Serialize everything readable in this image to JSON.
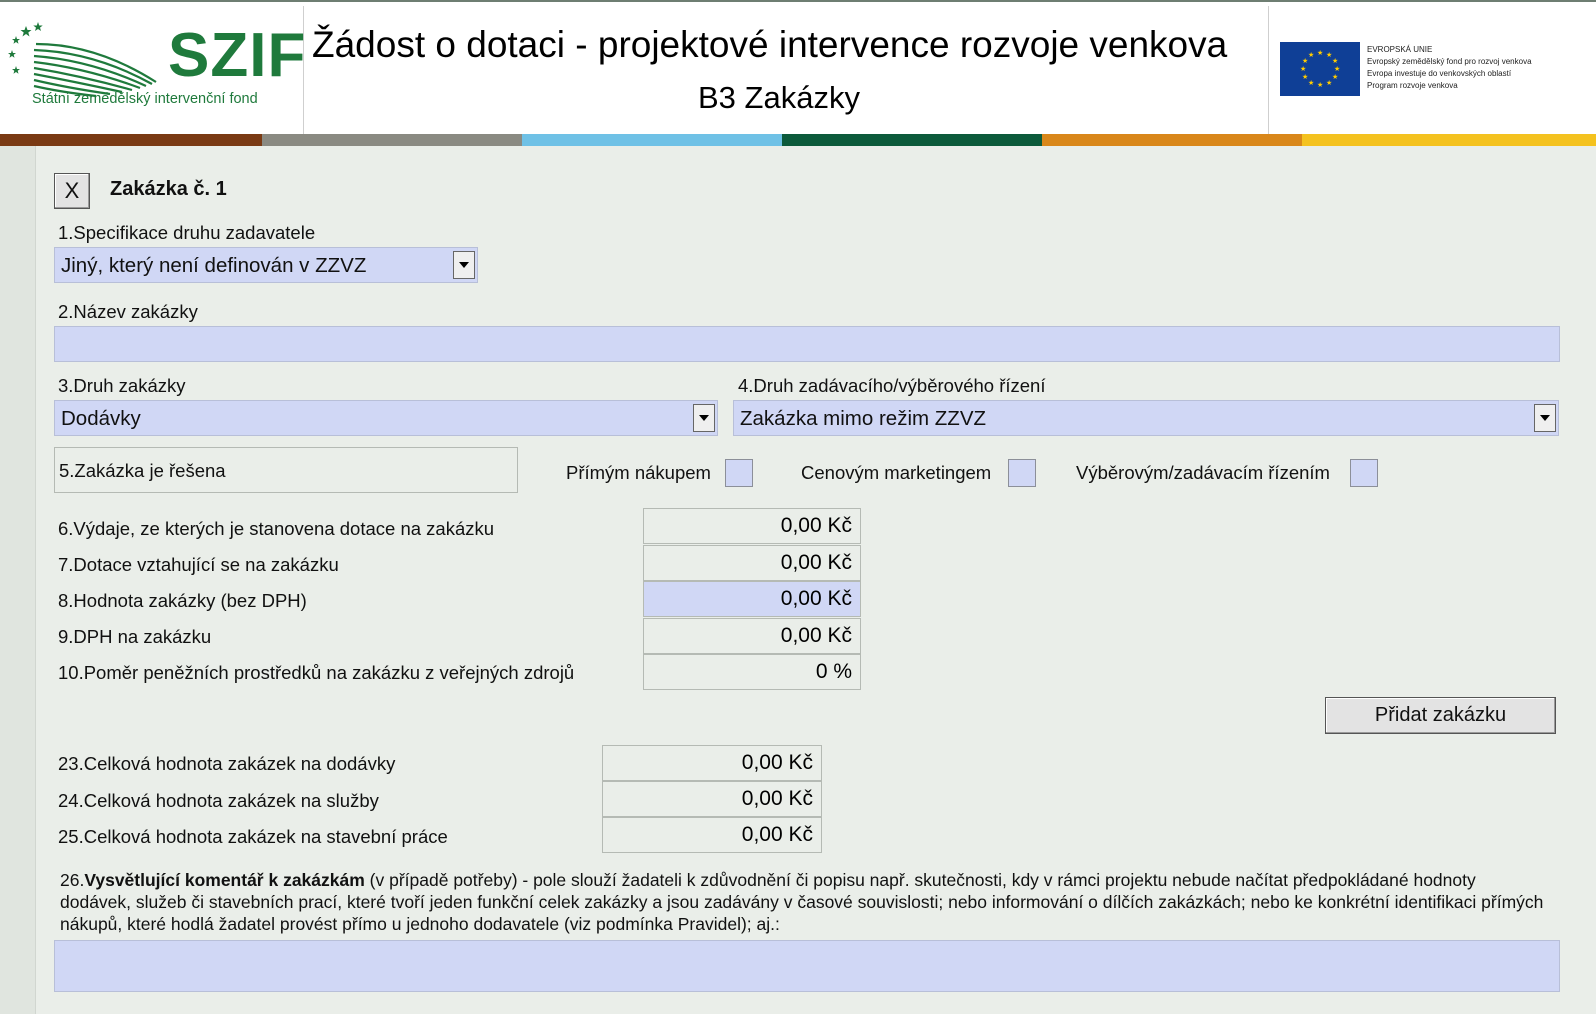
{
  "header": {
    "logo_text": "SZIF",
    "logo_subtitle": "Státní zemědělský intervenční fond",
    "title": "Žádost o dotaci - projektové intervence rozvoje venkova",
    "subtitle": "B3 Zakázky",
    "eu_lines": [
      "EVROPSKÁ UNIE",
      "Evropský zemědělský fond pro rozvoj venkova",
      "Evropa investuje do venkovských oblastí",
      "Program rozvoje venkova"
    ]
  },
  "stripe_colors": [
    "#7a3a14",
    "#8a8a82",
    "#6fc1e6",
    "#0c5a3b",
    "#d9871a",
    "#f4c21f"
  ],
  "contract": {
    "remove_label": "X",
    "heading": "Zakázka č. 1",
    "f1_label": "1.Specifikace druhu zadavatele",
    "f1_value": "Jiný, který není definován v ZZVZ",
    "f2_label": "2.Název zakázky",
    "f2_value": "",
    "f3_label": "3.Druh zakázky",
    "f3_value": "Dodávky",
    "f4_label": "4.Druh zadávacího/výběrového řízení",
    "f4_value": "Zakázka mimo režim ZZVZ",
    "f5_label": "5.Zakázka je řešena",
    "opt_direct": "Přímým nákupem",
    "opt_price": "Cenovým marketingem",
    "opt_tender": "Výběrovým/zadávacím řízením",
    "f6_label": "6.Výdaje, ze kterých je stanovena dotace na zakázku",
    "f6_value": "0,00 Kč",
    "f7_label": "7.Dotace vztahující se na zakázku",
    "f7_value": "0,00 Kč",
    "f8_label": "8.Hodnota zakázky (bez DPH)",
    "f8_value": "0,00 Kč",
    "f9_label": "9.DPH na zakázku",
    "f9_value": "0,00 Kč",
    "f10_label": "10.Poměr peněžních prostředků na zakázku z veřejných zdrojů",
    "f10_value": "0 %"
  },
  "add_button": "Přidat zakázku",
  "totals": {
    "t23_label": "23.Celková hodnota zakázek na dodávky",
    "t23_value": "0,00 Kč",
    "t24_label": "24.Celková hodnota zakázek na služby",
    "t24_value": "0,00 Kč",
    "t25_label": "25.Celková hodnota zakázek na stavební práce",
    "t25_value": "0,00 Kč"
  },
  "comment": {
    "num": "26.",
    "bold": "Vysvětlující komentář k zakázkám",
    "rest": " (v případě potřeby) - pole slouží žadateli k zdůvodnění či popisu např. skutečnosti, kdy v rámci projektu nebude načítat předpokládané hodnoty dodávek, služeb či stavebních prací, které tvoří jeden funkční celek zakázky a jsou zadávány v časové souvislosti; nebo informování o dílčích zakázkách; nebo ke konkrétní identifikaci přímých nákupů, které hodlá žadatel provést přímo u jednoho dodavatele (viz podmínka Pravidel); aj.:",
    "value": ""
  }
}
